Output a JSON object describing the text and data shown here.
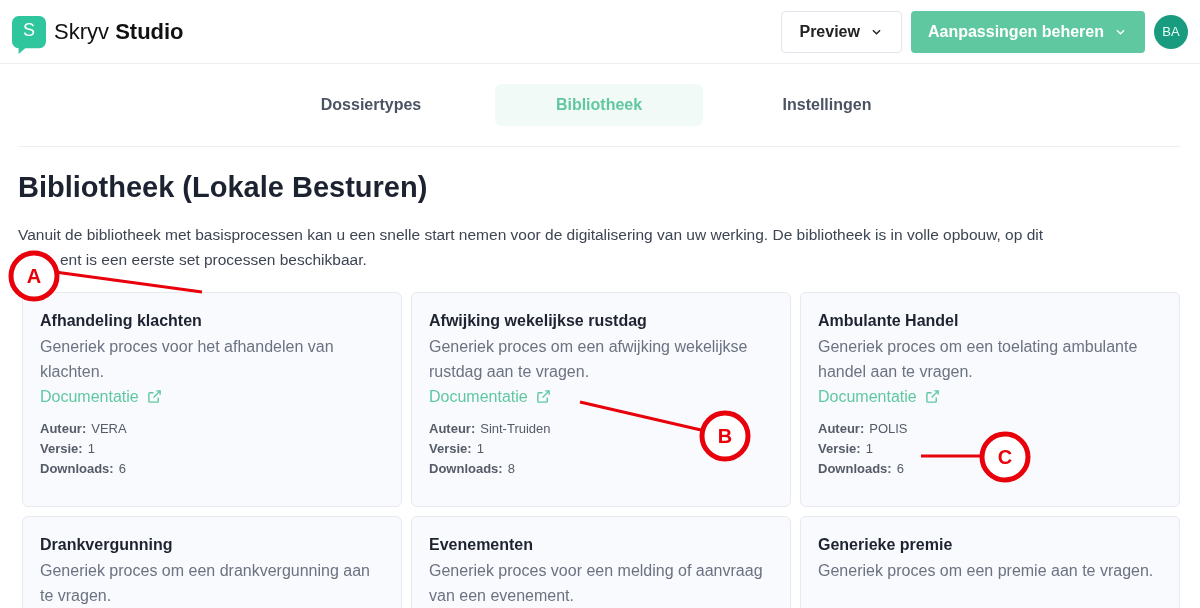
{
  "header": {
    "logo_letter": "S",
    "brand_light": "Skryv",
    "brand_bold": "Studio",
    "buttons": [
      {
        "label": "Preview",
        "kind": "outline"
      },
      {
        "label": "Aanpassingen beheren",
        "kind": "primary"
      }
    ],
    "avatar": "BA"
  },
  "tabs": [
    {
      "label": "Dossiertypes",
      "selected": false
    },
    {
      "label": "Bibliotheek",
      "selected": true
    },
    {
      "label": "Instellingen",
      "selected": false
    }
  ],
  "title": "Bibliotheek (Lokale Besturen)",
  "intro": {
    "line_1": "Vanuit de bibliotheek met basisprocessen kan u een snelle start nemen voor de digitalisering van uw werking. De bibliotheek is in volle opbouw, op dit",
    "line_2": "ent is een eerste set processen beschikbaar."
  },
  "cards": [
    {
      "title": "Afhandeling klachten",
      "description": "Generiek proces voor het afhandelen van klachten.",
      "link": "Documentatie",
      "meta": [
        {
          "label": "Auteur:",
          "value": "VERA"
        },
        {
          "label": "Versie:",
          "value": "1"
        },
        {
          "label": "Downloads:",
          "value": "6"
        }
      ]
    },
    {
      "title": "Afwijking wekelijkse rustdag",
      "description": "Generiek proces om een afwijking wekelijkse rustdag aan te vragen.",
      "link": "Documentatie",
      "meta": [
        {
          "label": "Auteur:",
          "value": "Sint-Truiden"
        },
        {
          "label": "Versie:",
          "value": "1"
        },
        {
          "label": "Downloads:",
          "value": "8"
        }
      ]
    },
    {
      "title": "Ambulante Handel",
      "description": "Generiek proces om een toelating ambulante handel aan te vragen.",
      "link": "Documentatie",
      "meta": [
        {
          "label": "Auteur:",
          "value": "POLIS"
        },
        {
          "label": "Versie:",
          "value": "1"
        },
        {
          "label": "Downloads:",
          "value": "6"
        }
      ]
    },
    {
      "title": "Drankvergunning",
      "description": "Generiek proces om een drankvergunning aan te vragen."
    },
    {
      "title": "Evenementen",
      "description": "Generiek proces voor een melding of aanvraag van een evenement."
    },
    {
      "title": "Generieke premie",
      "description": "Generiek proces om een premie aan te vragen."
    }
  ],
  "callouts": [
    {
      "label": "A"
    },
    {
      "label": "B"
    },
    {
      "label": "C"
    }
  ]
}
